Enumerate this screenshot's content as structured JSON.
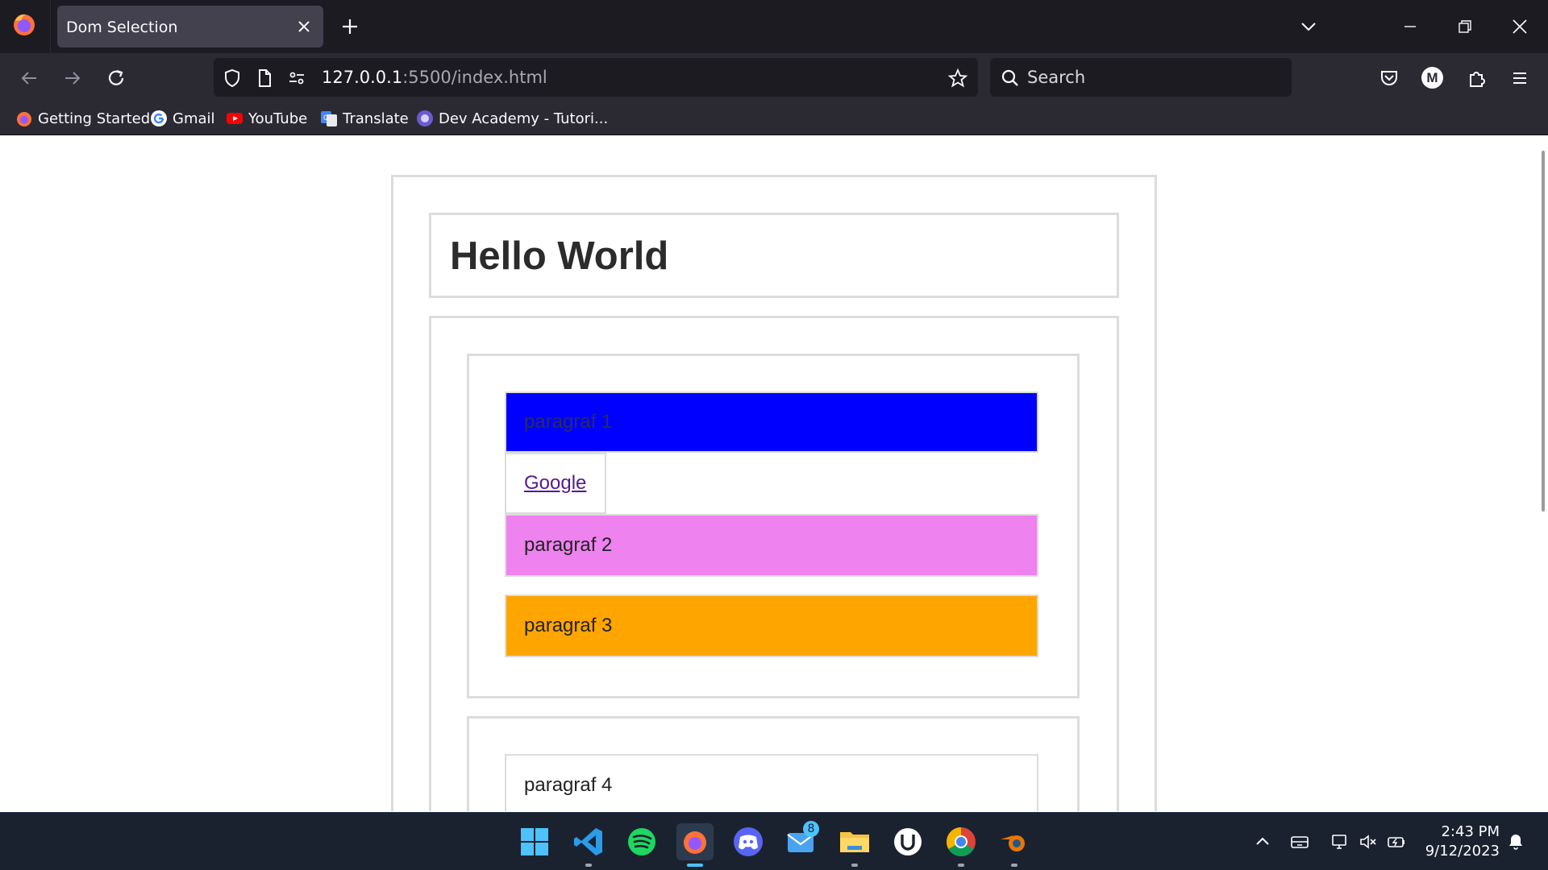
{
  "browser": {
    "tab_title": "Dom Selection",
    "url_host": "127.0.0.1",
    "url_path": ":5500/index.html",
    "search_placeholder": "Search",
    "profile_initial": "M",
    "bookmarks": [
      {
        "label": "Getting Started",
        "icon": "firefox-icon"
      },
      {
        "label": "Gmail",
        "icon": "google-icon"
      },
      {
        "label": "YouTube",
        "icon": "youtube-icon"
      },
      {
        "label": "Translate",
        "icon": "translate-icon"
      },
      {
        "label": "Dev Academy - Tutori...",
        "icon": "dev-academy-icon"
      }
    ]
  },
  "page": {
    "heading": "Hello World",
    "paragraphs": [
      {
        "text": "paragraf 1",
        "bg": "#0000ff",
        "color": "#2a2a66"
      },
      {
        "text": "paragraf 2",
        "bg": "#ee82ee",
        "color": "#222222"
      },
      {
        "text": "paragraf 3",
        "bg": "#ffa500",
        "color": "#222222"
      },
      {
        "text": "paragraf 4",
        "bg": "#ffffff",
        "color": "#222222"
      }
    ],
    "link_text": "Google"
  },
  "taskbar": {
    "apps": [
      "windows-start-icon",
      "vscode-icon",
      "spotify-icon",
      "firefox-icon",
      "discord-icon",
      "mail-icon",
      "file-explorer-icon",
      "upwork-icon",
      "chrome-icon",
      "blender-icon"
    ],
    "mail_badge": "8",
    "time": "2:43 PM",
    "date": "9/12/2023"
  }
}
